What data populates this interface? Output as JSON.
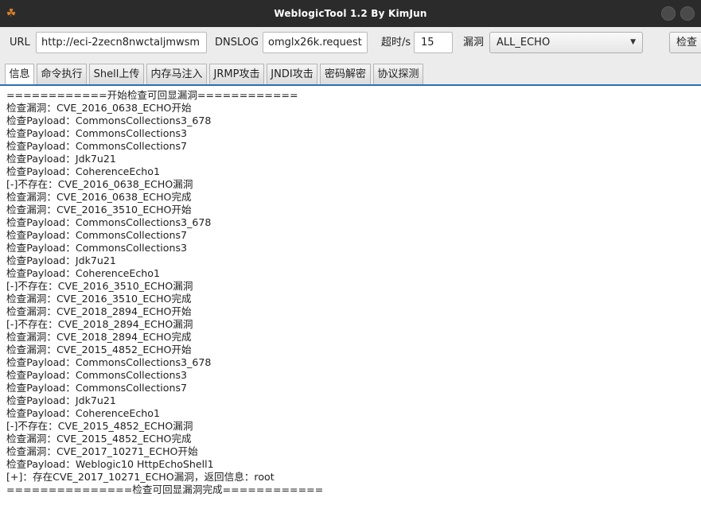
{
  "window": {
    "title": "WeblogicTool 1.2 By KimJun",
    "icon": "weblogic-app-icon"
  },
  "toolbar": {
    "url_label": "URL",
    "url_value": "http://eci-2zecn8nwctaljmwsm",
    "dnslog_label": "DNSLOG",
    "dnslog_value": "omglx26k.request",
    "timeout_label": "超时/s",
    "timeout_value": "15",
    "vuln_label": "漏洞",
    "vuln_selected": "ALL_ECHO",
    "check_button": "检查"
  },
  "tabs": [
    {
      "label": "信息",
      "active": true
    },
    {
      "label": "命令执行",
      "active": false
    },
    {
      "label": "Shell上传",
      "active": false
    },
    {
      "label": "内存马注入",
      "active": false
    },
    {
      "label": "JRMP攻击",
      "active": false
    },
    {
      "label": "JNDI攻击",
      "active": false
    },
    {
      "label": "密码解密",
      "active": false
    },
    {
      "label": "协议探测",
      "active": false
    }
  ],
  "log": [
    "============开始检查可回显漏洞============",
    "检查漏洞：CVE_2016_0638_ECHO开始",
    "检查Payload：CommonsCollections3_678",
    "检查Payload：CommonsCollections3",
    "检查Payload：CommonsCollections7",
    "检查Payload：Jdk7u21",
    "检查Payload：CoherenceEcho1",
    "[-]不存在：CVE_2016_0638_ECHO漏洞",
    "检查漏洞：CVE_2016_0638_ECHO完成",
    "检查漏洞：CVE_2016_3510_ECHO开始",
    "检查Payload：CommonsCollections3_678",
    "检查Payload：CommonsCollections7",
    "检查Payload：CommonsCollections3",
    "检查Payload：Jdk7u21",
    "检查Payload：CoherenceEcho1",
    "[-]不存在：CVE_2016_3510_ECHO漏洞",
    "检查漏洞：CVE_2016_3510_ECHO完成",
    "检查漏洞：CVE_2018_2894_ECHO开始",
    "[-]不存在：CVE_2018_2894_ECHO漏洞",
    "检查漏洞：CVE_2018_2894_ECHO完成",
    "检查漏洞：CVE_2015_4852_ECHO开始",
    "检查Payload：CommonsCollections3_678",
    "检查Payload：CommonsCollections3",
    "检查Payload：CommonsCollections7",
    "检查Payload：Jdk7u21",
    "检查Payload：CoherenceEcho1",
    "[-]不存在：CVE_2015_4852_ECHO漏洞",
    "检查漏洞：CVE_2015_4852_ECHO完成",
    "检查漏洞：CVE_2017_10271_ECHO开始",
    "检查Payload：Weblogic10 HttpEchoShell1",
    "[+]：存在CVE_2017_10271_ECHO漏洞，返回信息：root",
    "===============检查可回显漏洞完成============"
  ]
}
